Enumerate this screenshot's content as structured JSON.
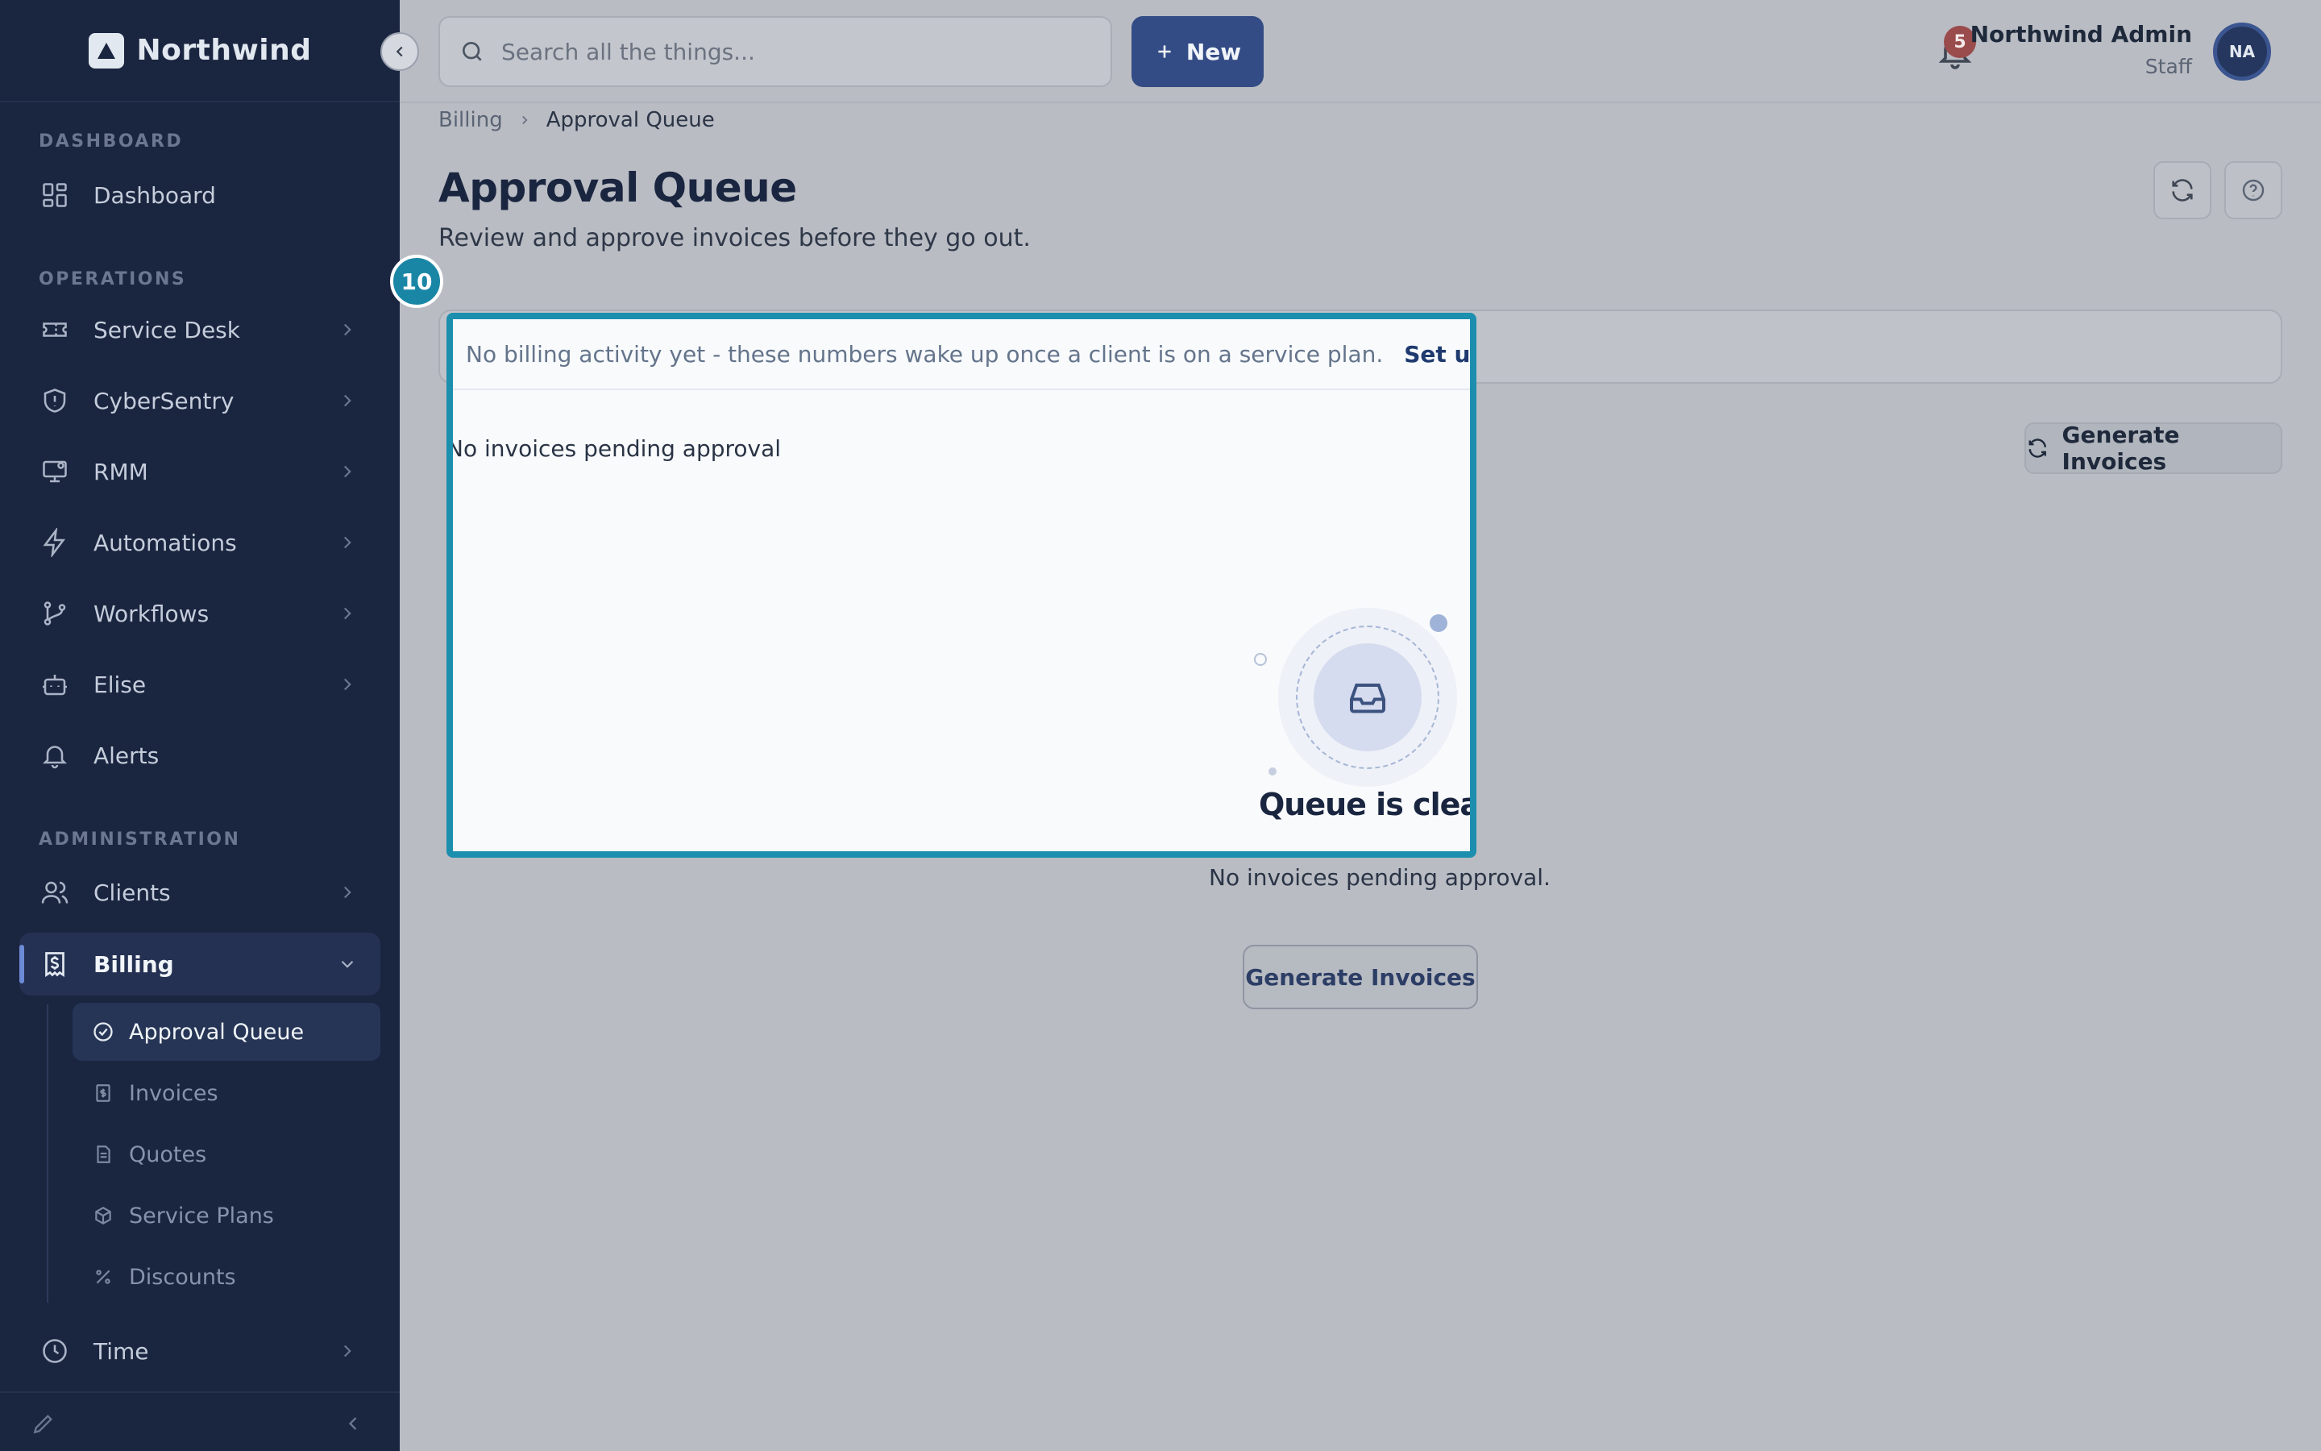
{
  "brand": {
    "name": "Northwind"
  },
  "sidebar": {
    "sections": {
      "dashboard": "DASHBOARD",
      "operations": "OPERATIONS",
      "administration": "ADMINISTRATION"
    },
    "items": {
      "dashboard": "Dashboard",
      "service_desk": "Service Desk",
      "cybersentry": "CyberSentry",
      "rmm": "RMM",
      "automations": "Automations",
      "workflows": "Workflows",
      "elise": "Elise",
      "alerts": "Alerts",
      "clients": "Clients",
      "billing": "Billing",
      "time": "Time"
    },
    "billing_children": {
      "approval_queue": "Approval Queue",
      "invoices": "Invoices",
      "quotes": "Quotes",
      "service_plans": "Service Plans",
      "discounts": "Discounts"
    }
  },
  "topbar": {
    "search_placeholder": "Search all the things...",
    "new_label": "New",
    "notification_count": "5",
    "user_name": "Northwind Admin",
    "user_role": "Staff",
    "avatar_initials": "NA"
  },
  "breadcrumb": {
    "parent": "Billing",
    "current": "Approval Queue"
  },
  "page": {
    "title": "Approval Queue",
    "subtitle": "Review and approve invoices before they go out.",
    "notice_text": "No billing activity yet - these numbers wake up once a client is on a service plan.",
    "notice_link": "Set up a service plan →",
    "pending_text": "No invoices pending approval",
    "generate_label": "Generate Invoices",
    "empty_title": "Queue is clear",
    "empty_subtitle": "No invoices pending approval.",
    "empty_button": "Generate Invoices"
  },
  "tutorial": {
    "step_number": "10"
  },
  "colors": {
    "sidebar_bg": "#1a2540",
    "accent": "#344c86",
    "highlight": "#1c8eae",
    "badge": "#9a4b4b"
  }
}
